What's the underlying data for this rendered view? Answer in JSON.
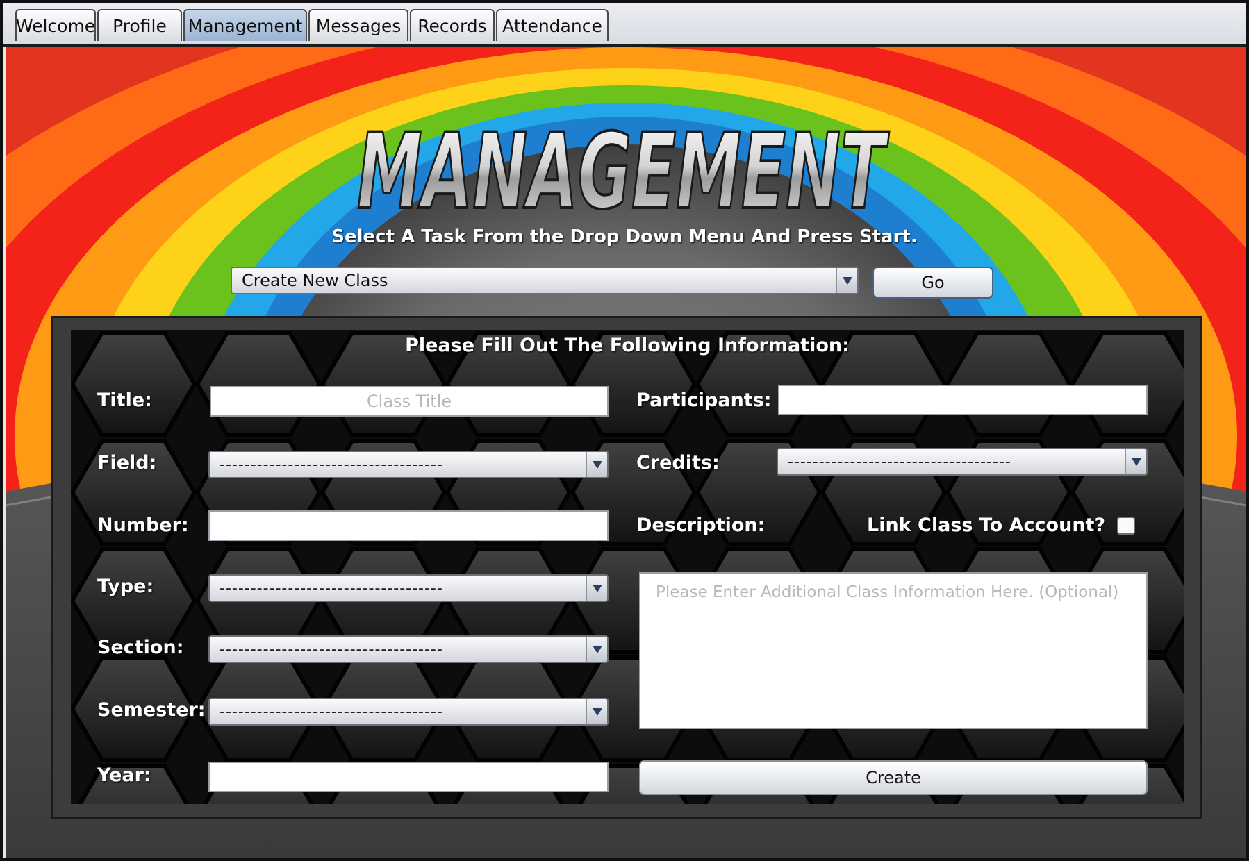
{
  "tabs": [
    {
      "label": "Welcome"
    },
    {
      "label": "Profile"
    },
    {
      "label": "Management"
    },
    {
      "label": "Messages"
    },
    {
      "label": "Records"
    },
    {
      "label": "Attendance"
    }
  ],
  "active_tab": "Management",
  "header": {
    "logo_text": "MANAGEMENT",
    "instruction": "Select A Task From the Drop Down Menu And Press Start."
  },
  "task": {
    "selected": "Create New Class",
    "go_label": "Go"
  },
  "form": {
    "heading": "Please Fill Out The Following Information:",
    "title_label": "Title:",
    "title_placeholder": "Class Title",
    "participants_label": "Participants:",
    "participants_value": "",
    "field_label": "Field:",
    "field_value": "------------------------------------",
    "credits_label": "Credits:",
    "credits_value": "------------------------------------",
    "number_label": "Number:",
    "number_value": "",
    "description_label": "Description:",
    "link_label": "Link Class To Account?",
    "link_checked": false,
    "type_label": "Type:",
    "type_value": "------------------------------------",
    "section_label": "Section:",
    "section_value": "------------------------------------",
    "semester_label": "Semester:",
    "semester_value": "------------------------------------",
    "year_label": "Year:",
    "year_value": "",
    "description_placeholder": "Please Enter Additional Class Information Here. (Optional)",
    "create_label": "Create"
  },
  "colors": {
    "active_tab": "#9ab4d2",
    "button_border": "#49607f",
    "panel_background": "#111111",
    "label_text": "#ffffff"
  }
}
